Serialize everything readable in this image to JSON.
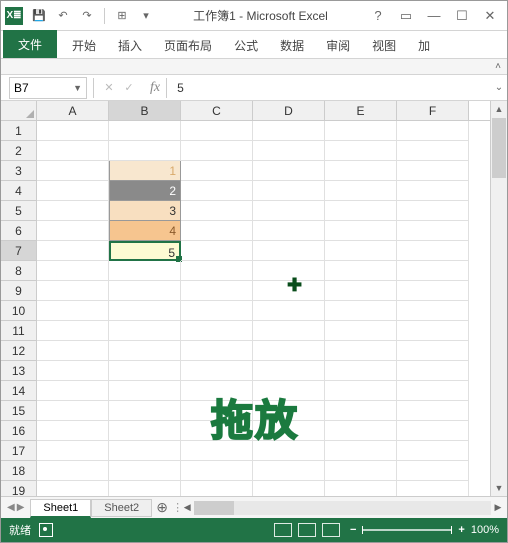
{
  "titlebar": {
    "app_abbr": "X≣",
    "title": "工作簿1 - Microsoft Excel",
    "qat": {
      "save": "💾",
      "undo": "↶",
      "redo": "↷",
      "touch": "⊞",
      "more": "▾"
    },
    "win": {
      "help": "?",
      "ribbon": "▭",
      "min": "—",
      "max": "☐",
      "close": "✕"
    }
  },
  "ribbon": {
    "file": "文件",
    "tabs": [
      "开始",
      "插入",
      "页面布局",
      "公式",
      "数据",
      "审阅",
      "视图",
      "加"
    ]
  },
  "formula": {
    "namebox": "B7",
    "cancel": "✕",
    "enter": "✓",
    "fx": "fx",
    "value": "5"
  },
  "columns": [
    "A",
    "B",
    "C",
    "D",
    "E",
    "F"
  ],
  "selected_col": "B",
  "selected_row": 7,
  "row_count": 19,
  "cells": {
    "B3": "1",
    "B4": "2",
    "B5": "3",
    "B6": "4",
    "B7": "5"
  },
  "tabs": {
    "sheets": [
      "Sheet1",
      "Sheet2"
    ],
    "active": 0,
    "add": "⊕"
  },
  "status": {
    "ready": "就绪",
    "zoom_minus": "−",
    "zoom_plus": "+",
    "zoom_pct": "100%"
  },
  "overlay": {
    "cursor": "✚",
    "watermark": "拖放"
  }
}
